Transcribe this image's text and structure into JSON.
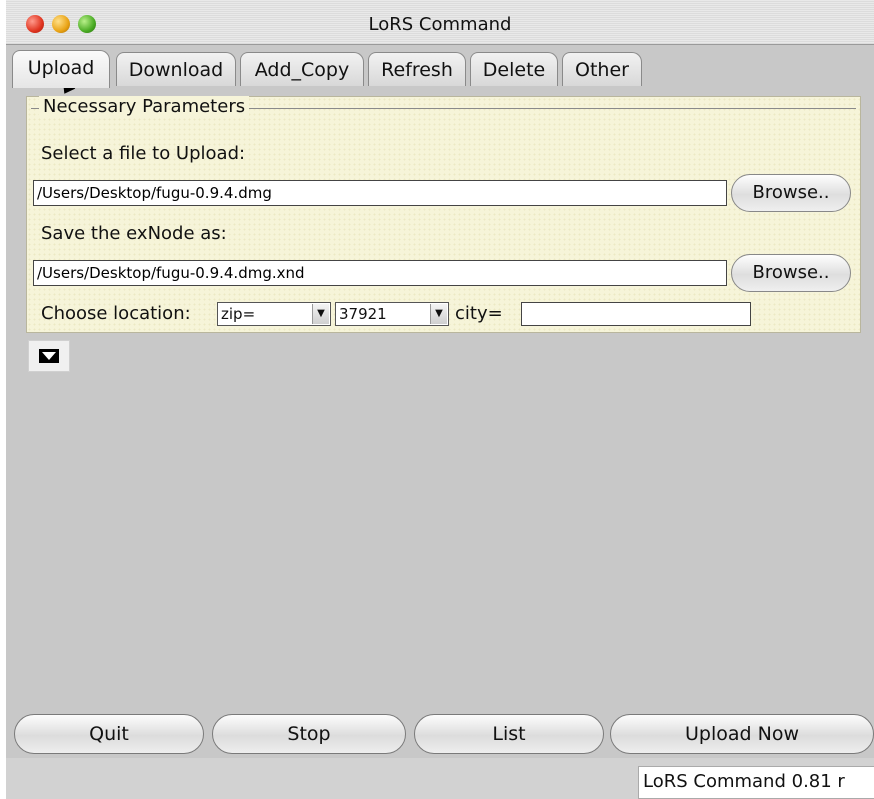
{
  "window": {
    "title": "LoRS Command"
  },
  "tabs": [
    {
      "label": "Upload",
      "active": true
    },
    {
      "label": "Download"
    },
    {
      "label": "Add_Copy"
    },
    {
      "label": "Refresh"
    },
    {
      "label": "Delete"
    },
    {
      "label": "Other"
    }
  ],
  "panel": {
    "legend": "Necessary Parameters",
    "select_file_label": "Select a file to Upload:",
    "file_path": "/Users/Desktop/fugu-0.9.4.dmg",
    "browse_label": "Browse..",
    "save_label": "Save the exNode as:",
    "exnode_path": "/Users/Desktop/fugu-0.9.4.dmg.xnd",
    "location_label": "Choose location:",
    "location_type": "zip=",
    "location_value": "37921",
    "city_label": "city=",
    "city_value": ""
  },
  "buttons": {
    "quit": "Quit",
    "stop": "Stop",
    "list": "List",
    "upload_now": "Upload Now"
  },
  "status": {
    "text": "LoRS Command 0.81 r"
  },
  "colors": {
    "panel_bg": "#f6f4d9",
    "window_bg": "#c8c8c8"
  }
}
